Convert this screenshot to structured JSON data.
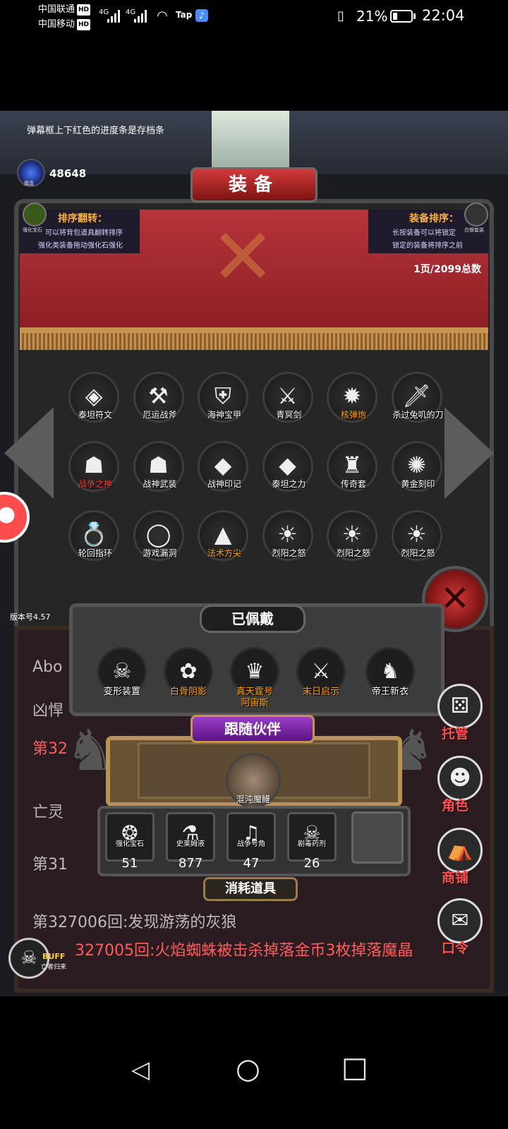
{
  "status_bar": {
    "carrier1": "中国联通",
    "carrier2": "中国移动",
    "hd": "HD",
    "net1": "4G",
    "net2": "4G",
    "tap": "Tap",
    "battery_pct": "21%",
    "time": "22:04"
  },
  "game": {
    "hint": "弹幕框上下红色的进度条是存档条",
    "gem_count": "48648",
    "gem_caption": "魔晶",
    "title": "装备",
    "left_info": {
      "icon_caption": "强化宝石",
      "title": "排序翻转：",
      "line1": "可以将背包道具翻转排序",
      "line2": "强化类装备拖动强化石强化"
    },
    "right_info": {
      "icon_caption": "白银套装",
      "title": "装备排序：",
      "line1": "长按装备可以将锁定",
      "line2": "锁定的装备将排序之前"
    },
    "pages": "1页/2099总数",
    "equipment": [
      {
        "name": "泰坦符文",
        "color": "white",
        "icon": "rune-icon",
        "glyph": "◈"
      },
      {
        "name": "厄运战斧",
        "color": "white",
        "icon": "axe-icon",
        "glyph": "⚒"
      },
      {
        "name": "海神宝甲",
        "color": "white",
        "icon": "armor-icon",
        "glyph": "⛨"
      },
      {
        "name": "青冥剑",
        "color": "white",
        "icon": "sword-icon",
        "glyph": "⚔"
      },
      {
        "name": "核弹炮",
        "color": "gold",
        "icon": "cannon-icon",
        "glyph": "✹"
      },
      {
        "name": "杀过兔叽的刀",
        "color": "white",
        "icon": "knife-icon",
        "glyph": "🗡"
      },
      {
        "name": "战争之神",
        "color": "red",
        "icon": "war-god-icon",
        "glyph": "☗"
      },
      {
        "name": "战神武装",
        "color": "white",
        "icon": "war-armor-icon",
        "glyph": "☗"
      },
      {
        "name": "战神印记",
        "color": "white",
        "icon": "war-mark-icon",
        "glyph": "◆"
      },
      {
        "name": "泰坦之力",
        "color": "white",
        "icon": "titan-power-icon",
        "glyph": "◆"
      },
      {
        "name": "传奇套",
        "color": "white",
        "icon": "legend-set-icon",
        "glyph": "♜"
      },
      {
        "name": "黄金刻印",
        "color": "white",
        "icon": "gold-seal-icon",
        "glyph": "✺"
      },
      {
        "name": "轮回指环",
        "color": "white",
        "icon": "ring-icon",
        "glyph": "💍"
      },
      {
        "name": "游戏漏洞",
        "color": "white",
        "icon": "portal-icon",
        "glyph": "◯"
      },
      {
        "name": "法术方尖",
        "color": "gold",
        "icon": "obelisk-icon",
        "glyph": "▲"
      },
      {
        "name": "烈阳之怒",
        "color": "white",
        "icon": "sun-fury-icon",
        "glyph": "☀"
      },
      {
        "name": "烈阳之怒",
        "color": "white",
        "icon": "sun-fury-icon",
        "glyph": "☀"
      },
      {
        "name": "烈阳之怒",
        "color": "white",
        "icon": "sun-fury-icon",
        "glyph": "☀"
      }
    ],
    "version": "版本号4.57",
    "worn_title": "已佩戴",
    "worn": [
      {
        "name": "变形装置",
        "color": "white",
        "icon": "skull-device-icon",
        "glyph": "☠"
      },
      {
        "name": "白骨阴影",
        "color": "gold",
        "icon": "bone-shadow-icon",
        "glyph": "✿"
      },
      {
        "name": "真天霆号\n阿宙斯",
        "color": "gold",
        "icon": "zeus-icon",
        "glyph": "♛"
      },
      {
        "name": "末日启示",
        "color": "gold",
        "icon": "doom-icon",
        "glyph": "⚔"
      },
      {
        "name": "帝王新衣",
        "color": "white",
        "icon": "emperor-cloth-icon",
        "glyph": "♞"
      }
    ],
    "companion_title": "跟随伙伴",
    "companion_name": "混沌魔鳗",
    "consumables": [
      {
        "name": "强化宝石",
        "count": "51",
        "icon": "enhance-gem-icon",
        "glyph": "❂"
      },
      {
        "name": "史莱姆液",
        "count": "877",
        "icon": "slime-potion-icon",
        "glyph": "⚗"
      },
      {
        "name": "战争号角",
        "count": "47",
        "icon": "war-horn-icon",
        "glyph": "♫"
      },
      {
        "name": "剧毒药剂",
        "count": "26",
        "icon": "poison-icon",
        "glyph": "☠"
      }
    ],
    "consumables_title": "消耗道具",
    "log": [
      {
        "text": "Abo",
        "color": "gray"
      },
      {
        "text": "凶悍",
        "color": "gray"
      },
      {
        "text": "第32",
        "color": "red"
      },
      {
        "text": "亡灵",
        "color": "gray"
      },
      {
        "text": "第31",
        "color": "gray"
      },
      {
        "text": "第327006回:发现游荡的灰狼",
        "color": "gray"
      },
      {
        "text": "327005回:火焰蜘蛛被击杀掉落金币3枚掉落魔晶",
        "color": "red"
      }
    ],
    "side_buttons": [
      {
        "label": "托管",
        "icon": "dice-icon",
        "glyph": "⚄"
      },
      {
        "label": "角色",
        "icon": "hooded-figure-icon",
        "glyph": "☻"
      },
      {
        "label": "商铺",
        "icon": "shop-icon",
        "glyph": "⛺"
      },
      {
        "label": "口令",
        "icon": "scroll-icon",
        "glyph": "✉"
      }
    ],
    "buff_label": "BUFF",
    "buff_sub": "亡者归来"
  },
  "nav": {
    "back": "◁",
    "home": "○",
    "recent": "□"
  }
}
